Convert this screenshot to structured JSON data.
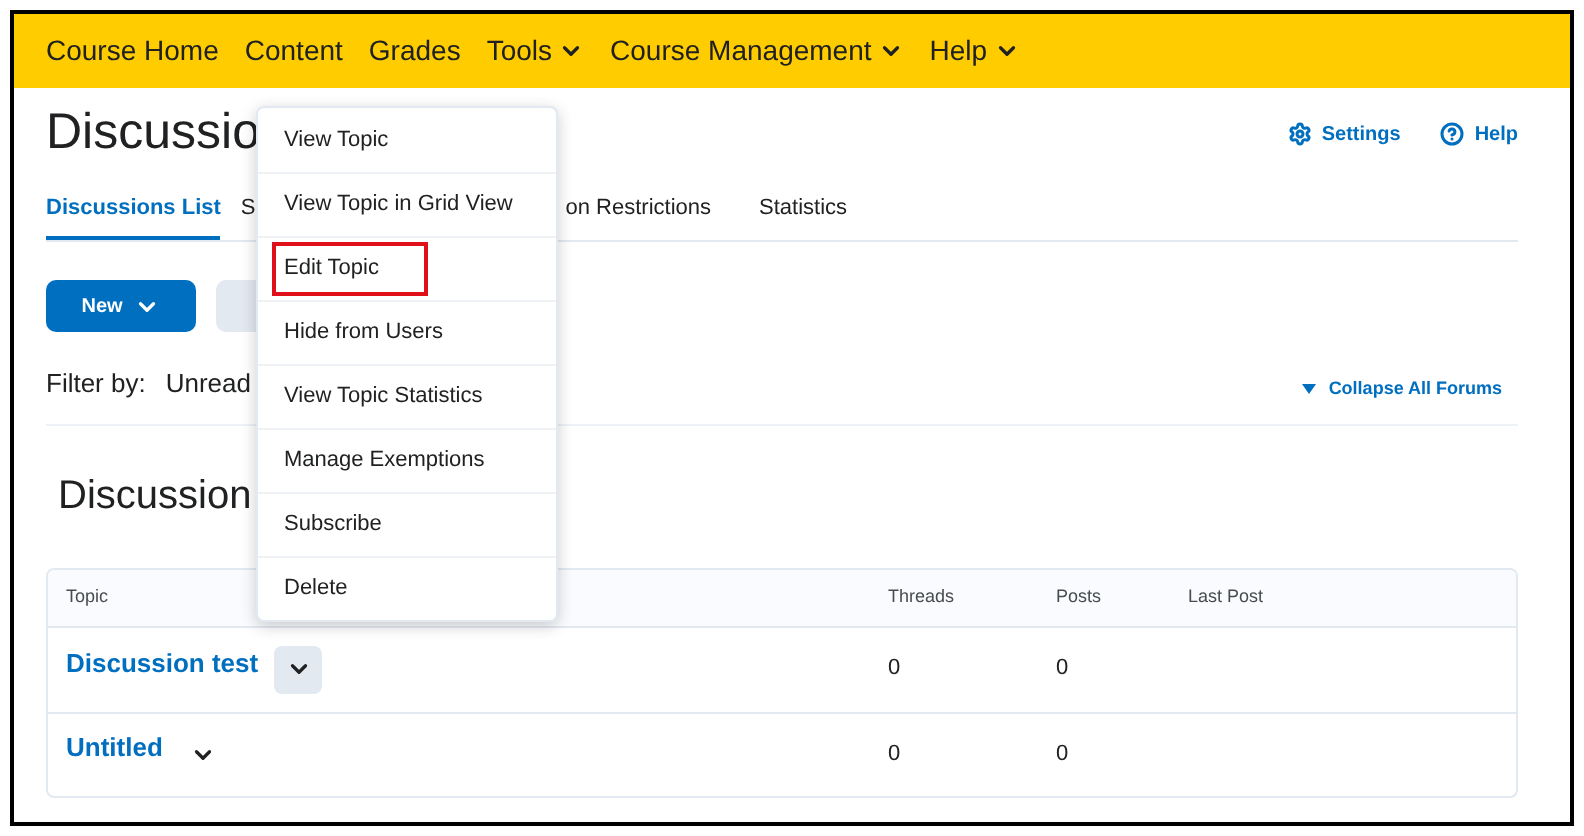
{
  "nav": [
    {
      "label": "Course Home",
      "dropdown": false
    },
    {
      "label": "Content",
      "dropdown": false
    },
    {
      "label": "Grades",
      "dropdown": false
    },
    {
      "label": "Tools",
      "dropdown": true
    },
    {
      "label": "Course Management",
      "dropdown": true
    },
    {
      "label": "Help",
      "dropdown": true
    }
  ],
  "page_title": "Discussio",
  "header_links": [
    {
      "kind": "settings",
      "label": "Settings"
    },
    {
      "kind": "help",
      "label": "Help"
    }
  ],
  "tabs": [
    {
      "label": "Discussions List",
      "selected": true
    },
    {
      "label": "S",
      "selected": false
    },
    {
      "label": "on Restrictions",
      "selected": false
    },
    {
      "label": "Statistics",
      "selected": false
    }
  ],
  "new_button": "New",
  "filter": {
    "label": "Filter by:",
    "value": "Unread"
  },
  "collapse_link": "Collapse All Forums",
  "forum_title": "Discussion",
  "table": {
    "columns": [
      "Topic",
      "Threads",
      "Posts",
      "Last Post"
    ],
    "rows": [
      {
        "topic": "Discussion test",
        "menu_open": true,
        "threads": "0",
        "posts": "0"
      },
      {
        "topic": "Untitled",
        "menu_open": false,
        "threads": "0",
        "posts": "0"
      }
    ]
  },
  "context_menu": [
    {
      "label": "View Topic",
      "marked": false
    },
    {
      "label": "View Topic in Grid View",
      "marked": false
    },
    {
      "label": "Edit Topic",
      "marked": true
    },
    {
      "label": "Hide from Users",
      "marked": false
    },
    {
      "label": "View Topic Statistics",
      "marked": false
    },
    {
      "label": "Manage Exemptions",
      "marked": false
    },
    {
      "label": "Subscribe",
      "marked": false
    },
    {
      "label": "Delete",
      "marked": false
    }
  ]
}
